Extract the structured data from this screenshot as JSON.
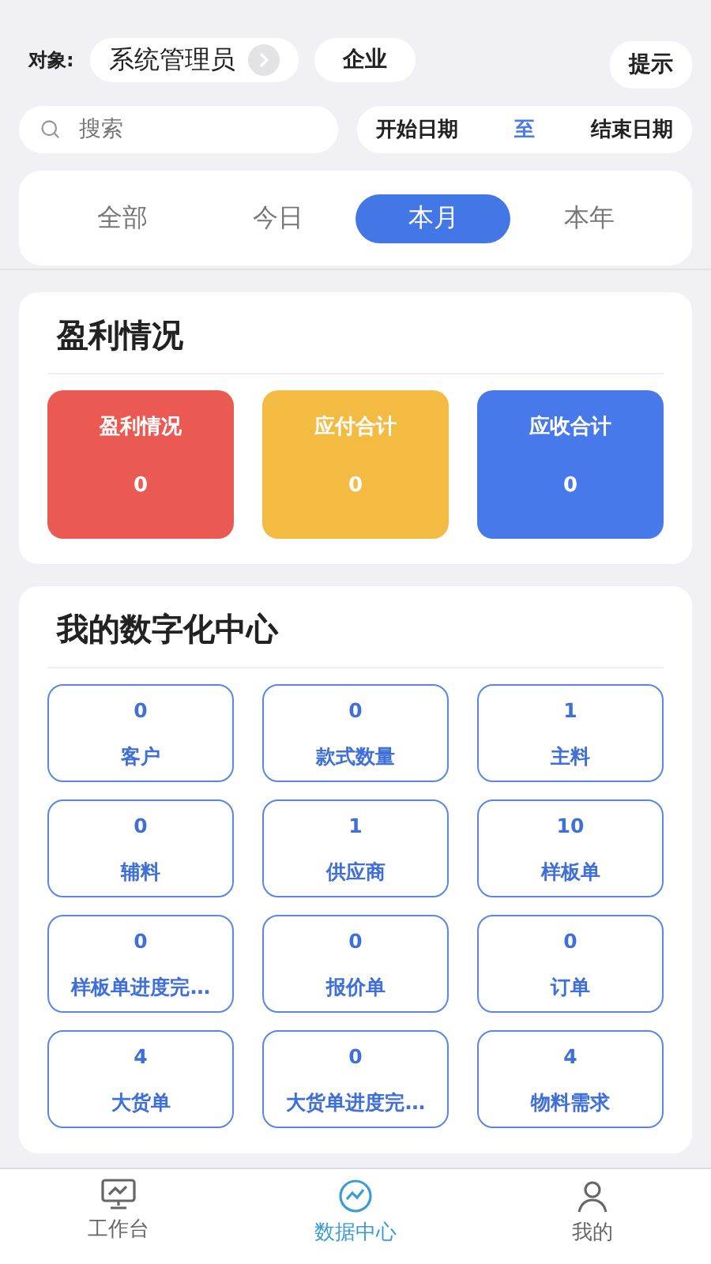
{
  "header": {
    "label": "对象:",
    "role": "系统管理员",
    "org": "企业",
    "hint_button": "提示"
  },
  "search": {
    "placeholder": "搜索"
  },
  "date_range": {
    "start": "开始日期",
    "separator": "至",
    "end": "结束日期"
  },
  "period_tabs": [
    {
      "label": "全部",
      "selected": false
    },
    {
      "label": "今日",
      "selected": false
    },
    {
      "label": "本月",
      "selected": true
    },
    {
      "label": "本年",
      "selected": false
    }
  ],
  "profit": {
    "title": "盈利情况",
    "cards": [
      {
        "label": "盈利情况",
        "value": "0",
        "color": "#eb5a52"
      },
      {
        "label": "应付合计",
        "value": "0",
        "color": "#f4bb42"
      },
      {
        "label": "应收合计",
        "value": "0",
        "color": "#4779ea"
      }
    ]
  },
  "digital_center": {
    "title": "我的数字化中心",
    "tiles": [
      {
        "value": "0",
        "label": "客户"
      },
      {
        "value": "0",
        "label": "款式数量"
      },
      {
        "value": "1",
        "label": "主料"
      },
      {
        "value": "0",
        "label": "辅料"
      },
      {
        "value": "1",
        "label": "供应商"
      },
      {
        "value": "10",
        "label": "样板单"
      },
      {
        "value": "0",
        "label": "样板单进度完..."
      },
      {
        "value": "0",
        "label": "报价单"
      },
      {
        "value": "0",
        "label": "订单"
      },
      {
        "value": "4",
        "label": "大货单"
      },
      {
        "value": "0",
        "label": "大货单进度完..."
      },
      {
        "value": "4",
        "label": "物料需求"
      }
    ]
  },
  "bottom_nav": [
    {
      "label": "工作台",
      "selected": false
    },
    {
      "label": "数据中心",
      "selected": true
    },
    {
      "label": "我的",
      "selected": false
    }
  ]
}
